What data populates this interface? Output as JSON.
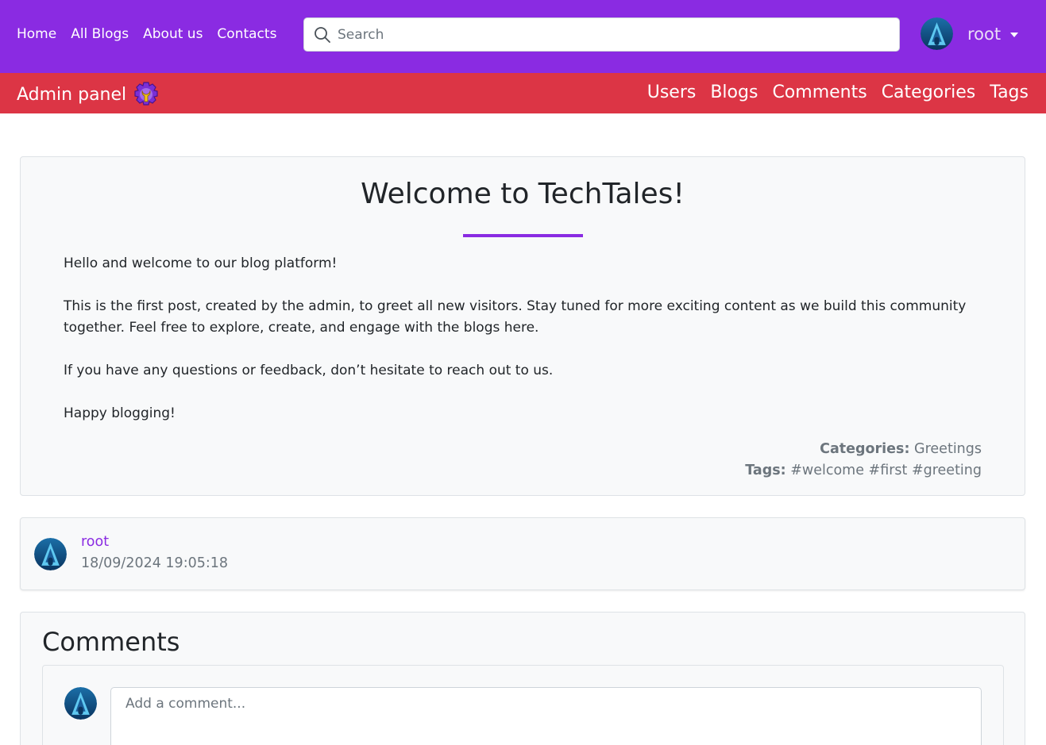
{
  "colors": {
    "brand": "#8a2be2",
    "admin_bar": "#dc3545",
    "card_bg": "#f8f9fa",
    "muted": "#6c757d"
  },
  "topnav": {
    "links": [
      "Home",
      "All Blogs",
      "About us",
      "Contacts"
    ],
    "search_placeholder": "Search",
    "user": "root"
  },
  "admin": {
    "title": "Admin panel",
    "links": [
      "Users",
      "Blogs",
      "Comments",
      "Categories",
      "Tags"
    ]
  },
  "post": {
    "title": "Welcome to TechTales!",
    "paragraphs": [
      "Hello and welcome to our blog platform!",
      "This is the first post, created by the admin, to greet all new visitors. Stay tuned for more exciting content as we build this community together. Feel free to explore, create, and engage with the blogs here.",
      "If you have any questions or feedback, don’t hesitate to reach out to us.",
      "Happy blogging!"
    ],
    "categories_label": "Categories:",
    "categories": "Greetings",
    "tags_label": "Tags:",
    "tags": "#welcome #first #greeting"
  },
  "author": {
    "name": "root",
    "date": "18/09/2024 19:05:18"
  },
  "comments": {
    "title": "Comments",
    "placeholder": "Add a comment..."
  }
}
